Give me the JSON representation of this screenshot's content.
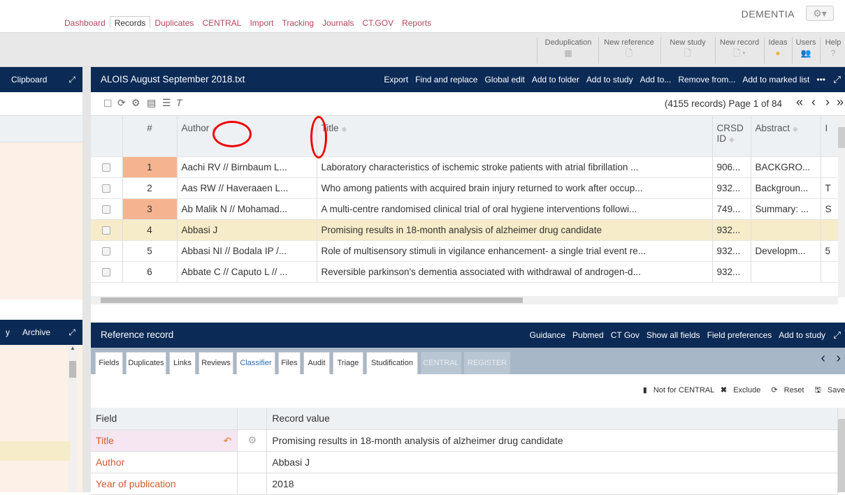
{
  "nav": {
    "links": [
      "Dashboard",
      "Records",
      "Duplicates",
      "CENTRAL",
      "Import",
      "Tracking",
      "Journals",
      "CT.GOV",
      "Reports"
    ],
    "active": "Records",
    "db_name": "DEMENTIA",
    "settings_icon": "gear-icon"
  },
  "toolbar": {
    "items": [
      {
        "label": "Deduplication",
        "icon": "dedup-icon"
      },
      {
        "label": "New reference",
        "icon": "document-icon"
      },
      {
        "label": "New study",
        "icon": "document-icon"
      },
      {
        "label": "New record",
        "icon": "document-dropdown-icon"
      },
      {
        "label": "Ideas",
        "icon": "lightbulb-icon"
      },
      {
        "label": "Users",
        "icon": "users-icon"
      },
      {
        "label": "Help",
        "icon": "question-icon"
      }
    ]
  },
  "left_panel": {
    "clipboard_title": "Clipboard",
    "archive_title": "Archive",
    "archive_prefix": "y"
  },
  "records_panel": {
    "title": "ALOIS August September 2018.txt",
    "actions": [
      "Export",
      "Find and replace",
      "Global edit",
      "Add to folder",
      "Add to study",
      "Add to...",
      "Remove from...",
      "Add to marked list",
      "•••"
    ],
    "summary": "(4155 records) Page 1 of 84",
    "columns": [
      "#",
      "Author",
      "Title",
      "CRSD ID",
      "Abstract",
      "I"
    ],
    "rows": [
      {
        "num": "1",
        "author": "Aachi RV // Birnbaum L...",
        "title": "Laboratory characteristics of ischemic stroke patients with atrial fibrillation ...",
        "crsd": "906...",
        "abstract": "BACKGRO...",
        "extra": "",
        "flag": "orange"
      },
      {
        "num": "2",
        "author": "Aas RW // Haveraaen L...",
        "title": "Who among patients with acquired brain injury returned to work after occup...",
        "crsd": "932...",
        "abstract": "Backgroun...",
        "extra": "T",
        "flag": ""
      },
      {
        "num": "3",
        "author": "Ab Malik N // Mohamad...",
        "title": "A multi-centre randomised clinical trial of oral hygiene interventions followi...",
        "crsd": "749...",
        "abstract": "Summary: ...",
        "extra": "S",
        "flag": "orange"
      },
      {
        "num": "4",
        "author": "Abbasi J",
        "title": "Promising results in 18-month analysis of alzheimer drug candidate",
        "crsd": "932...",
        "abstract": "",
        "extra": "",
        "flag": "highlight"
      },
      {
        "num": "5",
        "author": "Abbasi NI // Bodala IP /...",
        "title": "Role of multisensory stimuli in vigilance enhancement- a single trial event re...",
        "crsd": "932...",
        "abstract": "Developm...",
        "extra": "5",
        "flag": ""
      },
      {
        "num": "6",
        "author": "Abbate C // Caputo L // ...",
        "title": "Reversible parkinson's dementia associated with withdrawal of androgen-d...",
        "crsd": "932...",
        "abstract": "",
        "extra": "",
        "flag": ""
      }
    ]
  },
  "reference_panel": {
    "title": "Reference record",
    "actions": [
      "Guidance",
      "Pubmed",
      "CT Gov",
      "Show all fields",
      "Field preferences",
      "Add to study"
    ],
    "tabs": [
      "Fields",
      "Duplicates",
      "Links",
      "Reviews",
      "Classifier",
      "Files",
      "Audit",
      "Triage",
      "Studification",
      "CENTRAL",
      "REGISTER"
    ],
    "record_actions": [
      "Not for CENTRAL",
      "Exclude",
      "Reset",
      "Save"
    ],
    "field_header": "Field",
    "value_header": "Record value",
    "fields": [
      {
        "name": "Title",
        "value": "Promising results in 18-month analysis of alzheimer drug candidate"
      },
      {
        "name": "Author",
        "value": "Abbasi J"
      },
      {
        "name": "Year of publication",
        "value": "2018"
      }
    ]
  }
}
